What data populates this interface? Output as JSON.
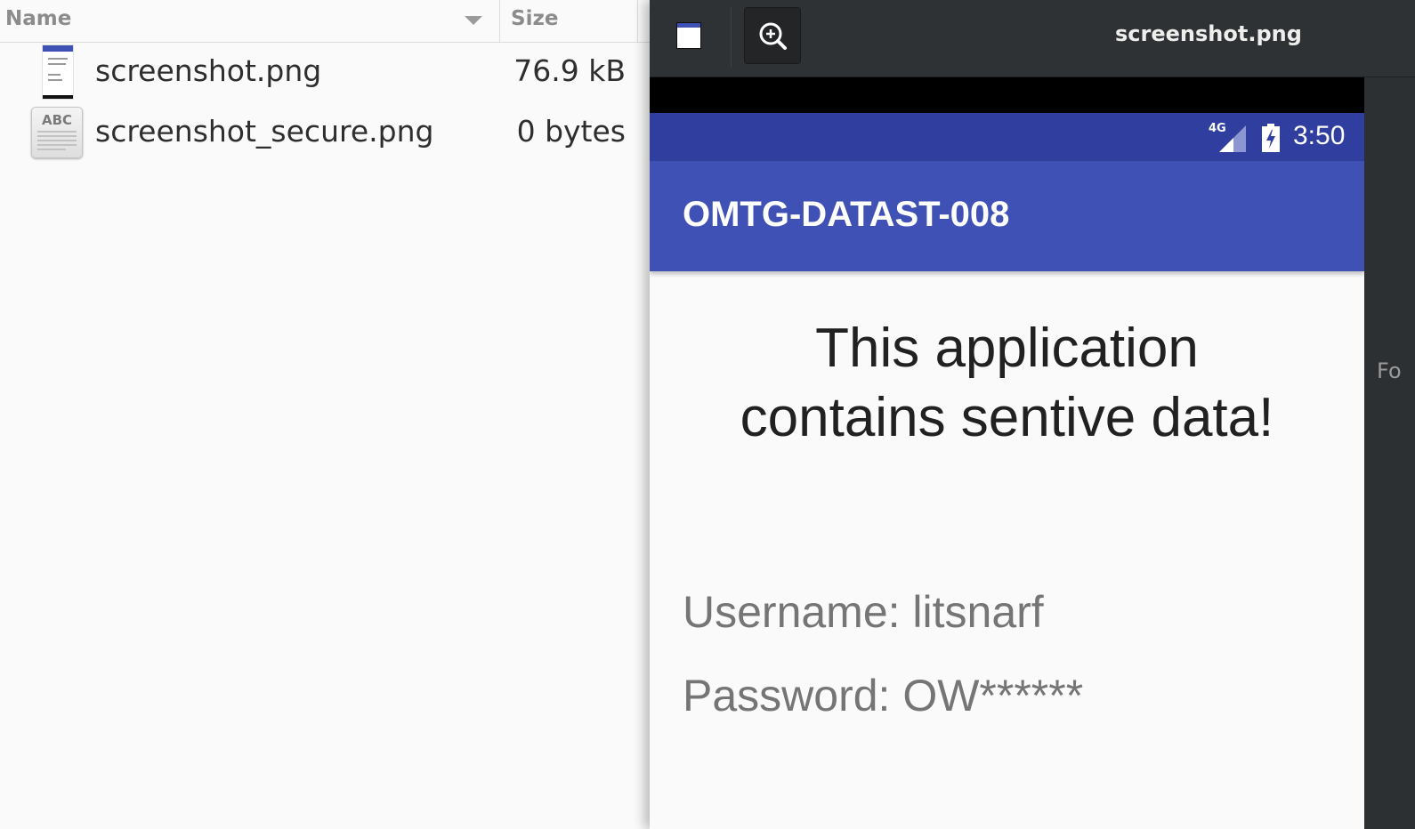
{
  "file_manager": {
    "columns": {
      "name": "Name",
      "size": "Size"
    },
    "files": [
      {
        "name": "screenshot.png",
        "size": "76.9 kB",
        "icon": "image-thumbnail-icon"
      },
      {
        "name": "screenshot_secure.png",
        "size": "0 bytes",
        "icon": "text-file-icon",
        "icon_text": "ABC"
      }
    ]
  },
  "viewer": {
    "title": "screenshot.png",
    "buttons": {
      "gallery": "gallery-icon",
      "zoom": "zoom-in-icon"
    },
    "side_text": "Fo",
    "phone": {
      "status": {
        "network": "4G",
        "time": "3:50"
      },
      "app_title": "OMTG-DATAST-008",
      "headline_line1": "This application",
      "headline_line2": "contains sentive data!",
      "username": "Username: litsnarf",
      "password": "Password: OW******"
    }
  },
  "colors": {
    "status_bar": "#303f9f",
    "app_bar": "#3f51b5",
    "viewer_bg": "#2d3033"
  }
}
